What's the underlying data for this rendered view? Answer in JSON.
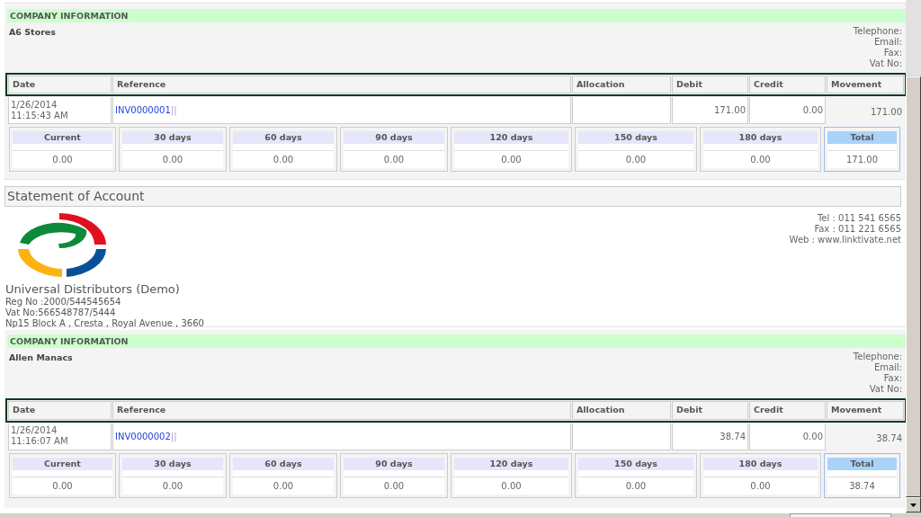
{
  "blocks": [
    {
      "kind": "account",
      "company_info": {
        "heading": "COMPANY INFORMATION",
        "name": "A6 Stores",
        "contact_labels": [
          "Telephone:",
          "Email:",
          "Fax:",
          "Vat No:"
        ]
      },
      "columns": [
        "Date",
        "Reference",
        "Allocation",
        "Debit",
        "Credit",
        "Movement"
      ],
      "rows": [
        {
          "date": "1/26/2014",
          "time": "11:15:43 AM",
          "reference": "INV0000001",
          "separator": "||",
          "debit": "171.00",
          "credit": "0.00",
          "movement": "171.00"
        }
      ],
      "aging": [
        {
          "kind": "bucket",
          "label": "Current",
          "value": "0.00"
        },
        {
          "kind": "bucket",
          "label": "30 days",
          "value": "0.00"
        },
        {
          "kind": "bucket",
          "label": "60 days",
          "value": "0.00"
        },
        {
          "kind": "bucket",
          "label": "90 days",
          "value": "0.00"
        },
        {
          "kind": "bucket",
          "label": "120 days",
          "value": "0.00"
        },
        {
          "kind": "bucket",
          "label": "150 days",
          "value": "0.00"
        },
        {
          "kind": "bucket",
          "label": "180 days",
          "value": "0.00"
        },
        {
          "kind": "total",
          "label": "Total",
          "value": "171.00"
        }
      ]
    },
    {
      "kind": "statement",
      "title": "Statement of Account",
      "company_name": "Universal Distributors (Demo)",
      "details": [
        "Reg No :2000/544545654",
        "Vat No:566548787/5444",
        "Np15 Block A , Cresta , Royal Avenue , 3660"
      ],
      "contacts": [
        "Tel : 011 541 6565",
        "Fax : 011 221 6565",
        "Web : www.linktivate.net"
      ]
    },
    {
      "kind": "account",
      "company_info": {
        "heading": "COMPANY INFORMATION",
        "name": "Allen Manacs",
        "contact_labels": [
          "Telephone:",
          "Email:",
          "Fax:",
          "Vat No:"
        ]
      },
      "columns": [
        "Date",
        "Reference",
        "Allocation",
        "Debit",
        "Credit",
        "Movement"
      ],
      "rows": [
        {
          "date": "1/26/2014",
          "time": "11:16:07 AM",
          "reference": "INV0000002",
          "separator": "||",
          "debit": "38.74",
          "credit": "0.00",
          "movement": "38.74"
        }
      ],
      "aging": [
        {
          "kind": "bucket",
          "label": "Current",
          "value": "0.00"
        },
        {
          "kind": "bucket",
          "label": "30 days",
          "value": "0.00"
        },
        {
          "kind": "bucket",
          "label": "60 days",
          "value": "0.00"
        },
        {
          "kind": "bucket",
          "label": "90 days",
          "value": "0.00"
        },
        {
          "kind": "bucket",
          "label": "120 days",
          "value": "0.00"
        },
        {
          "kind": "bucket",
          "label": "150 days",
          "value": "0.00"
        },
        {
          "kind": "bucket",
          "label": "180 days",
          "value": "0.00"
        },
        {
          "kind": "total",
          "label": "Total",
          "value": "38.74"
        }
      ]
    }
  ]
}
